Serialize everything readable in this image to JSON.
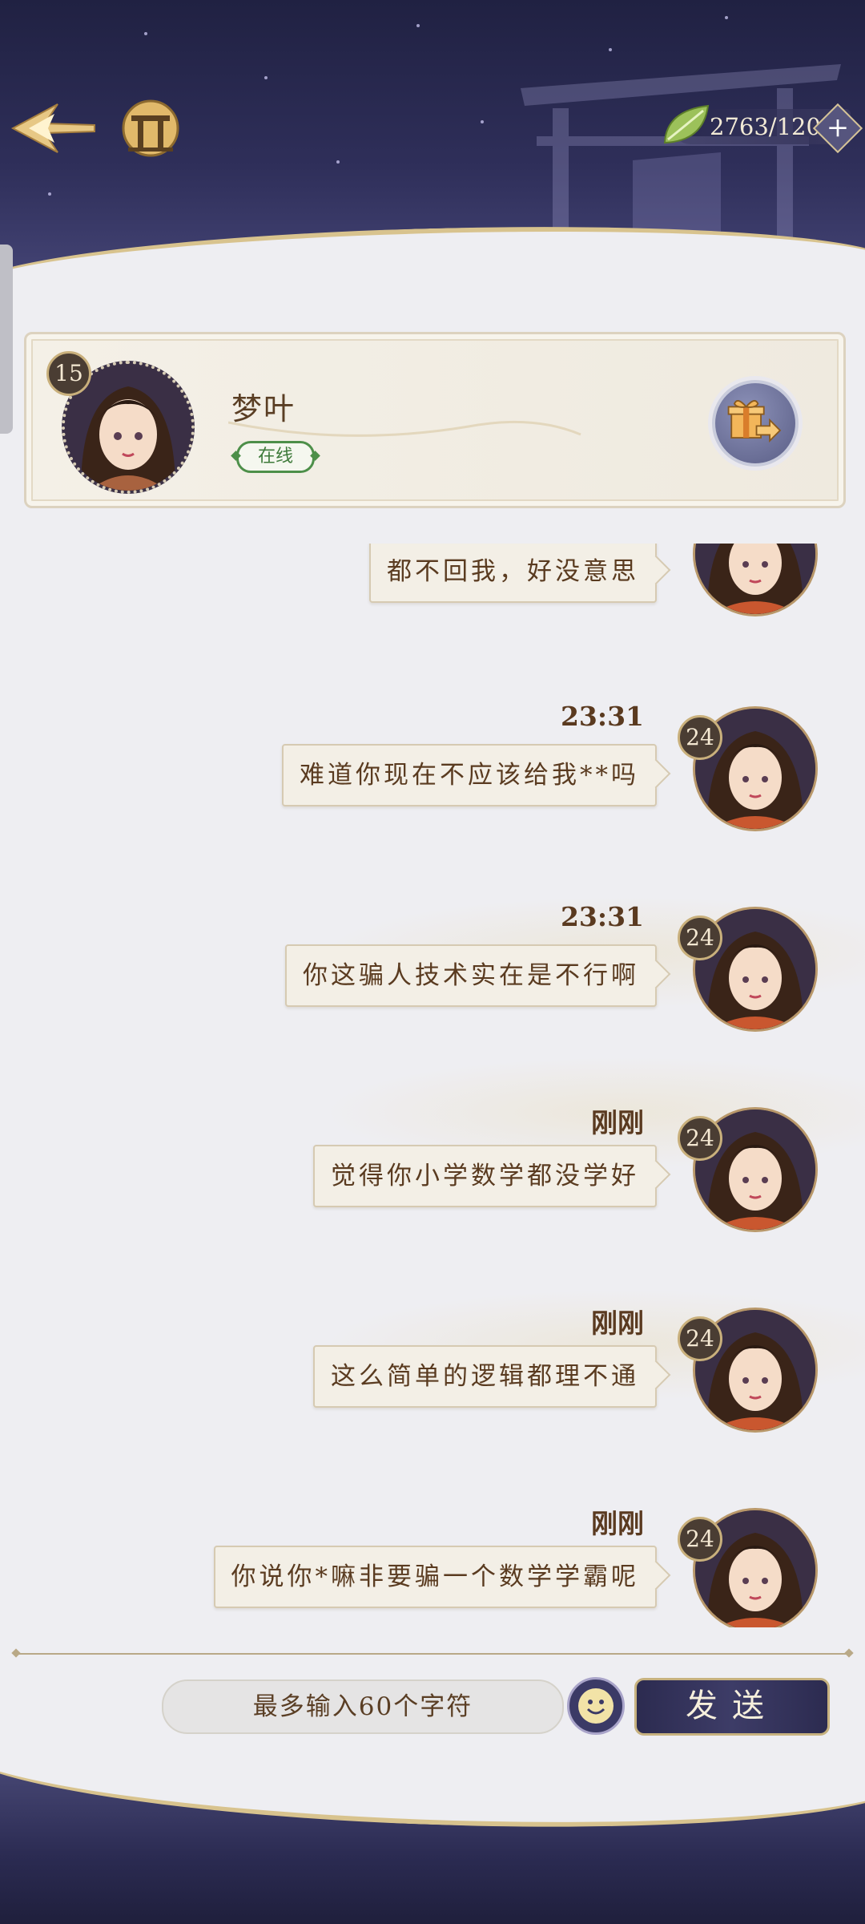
{
  "header": {
    "currency_value": "2763/120",
    "icons": {
      "back": "back-arrow-icon",
      "gate": "gate-icon",
      "currency": "leaf-icon",
      "add": "plus-icon"
    }
  },
  "profile": {
    "name": "梦叶",
    "level": "15",
    "status": "在线",
    "gift_icon": "gift-send-icon"
  },
  "messages": [
    {
      "time": "",
      "text": "都不回我，好没意思",
      "level": "24"
    },
    {
      "time": "23:31",
      "text": "难道你现在不应该给我**吗",
      "level": "24"
    },
    {
      "time": "23:31",
      "text": "你这骗人技术实在是不行啊",
      "level": "24"
    },
    {
      "time": "刚刚",
      "text": "觉得你小学数学都没学好",
      "level": "24"
    },
    {
      "time": "刚刚",
      "text": "这么简单的逻辑都理不通",
      "level": "24"
    },
    {
      "time": "刚刚",
      "text": "你说你*嘛非要骗一个数学学霸呢",
      "level": "24"
    }
  ],
  "input": {
    "placeholder": "最多输入60个字符",
    "emoji_icon": "smiley-icon",
    "send_label": "发送"
  },
  "colors": {
    "banner": "#2f2f5a",
    "gold": "#d8c38e",
    "bubble": "#f3efe6",
    "text": "#5a3b20",
    "online": "#4d8f49"
  }
}
